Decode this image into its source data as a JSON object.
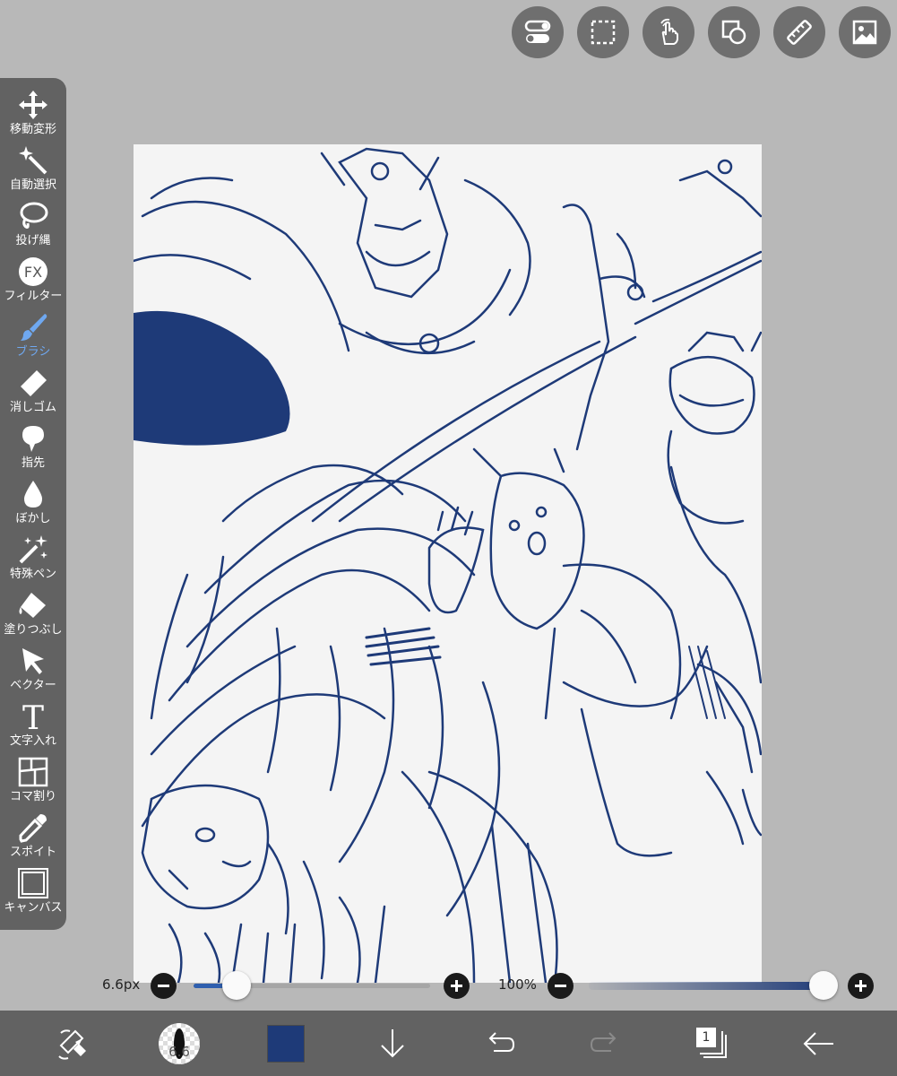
{
  "top_buttons": [
    {
      "name": "toggle-settings-button",
      "icon": "toggle-icon"
    },
    {
      "name": "selection-button",
      "icon": "dashed-selection-icon"
    },
    {
      "name": "gesture-button",
      "icon": "hand-touch-icon"
    },
    {
      "name": "shapes-button",
      "icon": "shapes-icon"
    },
    {
      "name": "ruler-button",
      "icon": "ruler-icon"
    },
    {
      "name": "material-button",
      "icon": "image-icon"
    }
  ],
  "tools": [
    {
      "label": "移動変形",
      "icon": "move-transform-icon"
    },
    {
      "label": "自動選択",
      "icon": "magic-wand-icon"
    },
    {
      "label": "投げ縄",
      "icon": "lasso-icon"
    },
    {
      "label": "フィルター",
      "icon": "fx-filter-icon"
    },
    {
      "label": "ブラシ",
      "icon": "brush-icon"
    },
    {
      "label": "消しゴム",
      "icon": "eraser-icon"
    },
    {
      "label": "指先",
      "icon": "smudge-icon"
    },
    {
      "label": "ぼかし",
      "icon": "blur-drop-icon"
    },
    {
      "label": "特殊ペン",
      "icon": "special-pen-icon"
    },
    {
      "label": "塗りつぶし",
      "icon": "bucket-fill-icon"
    },
    {
      "label": "ベクター",
      "icon": "vector-arrow-icon"
    },
    {
      "label": "文字入れ",
      "icon": "text-icon"
    },
    {
      "label": "コマ割り",
      "icon": "frame-divider-icon"
    },
    {
      "label": "スポイト",
      "icon": "eyedropper-icon"
    },
    {
      "label": "キャンバス",
      "icon": "canvas-icon"
    }
  ],
  "active_tool": "ブラシ",
  "brush_size": {
    "label": "6.6px",
    "fraction": 0.18
  },
  "opacity": {
    "label": "100%",
    "fraction": 1.0
  },
  "bottom": {
    "brush_preview_value": "6.6",
    "current_color": "#1e3a78",
    "layer_count": "1"
  },
  "colors": {
    "ink": "#1e3a78",
    "ui_dark": "#626262",
    "background": "#b8b8b8",
    "accent": "#6fa8f0"
  }
}
